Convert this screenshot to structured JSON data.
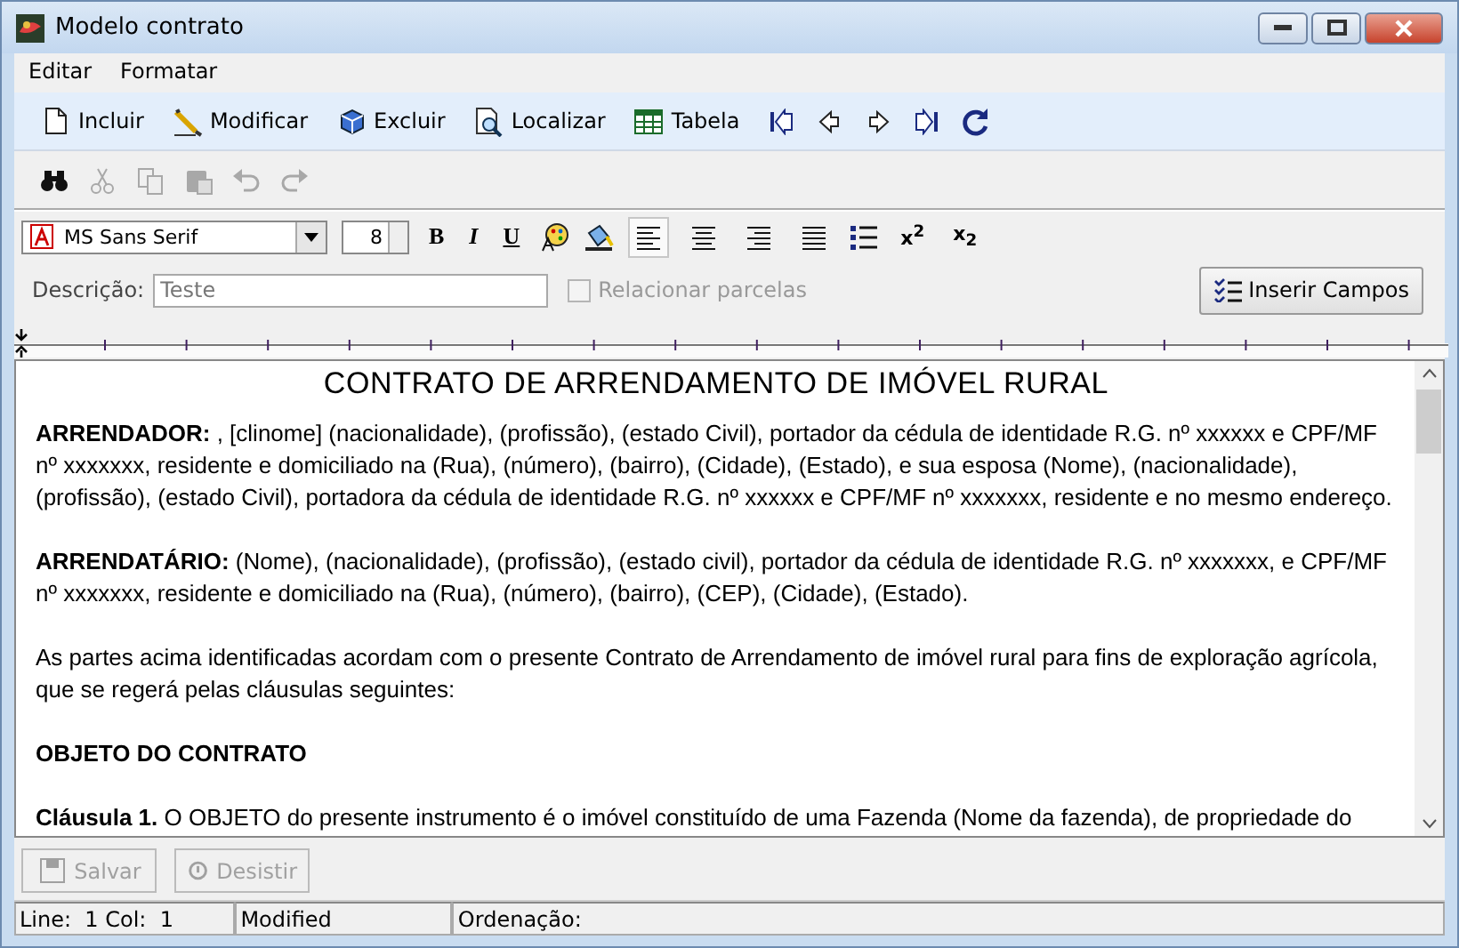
{
  "window": {
    "title": "Modelo contrato"
  },
  "menu": [
    {
      "label": "Editar"
    },
    {
      "label": "Formatar"
    }
  ],
  "toolbar": [
    {
      "kind": "new",
      "label": "Incluir"
    },
    {
      "kind": "edit",
      "label": "Modificar"
    },
    {
      "kind": "delete",
      "label": "Excluir"
    },
    {
      "kind": "find",
      "label": "Localizar"
    },
    {
      "kind": "table",
      "label": "Tabela"
    }
  ],
  "edit_tools": [
    {
      "kind": "binoculars",
      "disabled": false
    },
    {
      "kind": "cut",
      "disabled": true
    },
    {
      "kind": "copy",
      "disabled": true
    },
    {
      "kind": "paste",
      "disabled": true
    },
    {
      "kind": "undo",
      "disabled": true
    },
    {
      "kind": "redo",
      "disabled": true
    }
  ],
  "font": {
    "name": "MS Sans Serif",
    "size": "8"
  },
  "style_buttons": [
    {
      "kind": "bold",
      "label": "B"
    },
    {
      "kind": "italic",
      "label": "I"
    },
    {
      "kind": "underline",
      "label": "U"
    }
  ],
  "align_buttons": [
    {
      "kind": "left",
      "selected": true
    },
    {
      "kind": "center",
      "selected": false
    },
    {
      "kind": "right",
      "selected": false
    },
    {
      "kind": "justify",
      "selected": false
    }
  ],
  "script_buttons": [
    {
      "label": "x$^{2}$"
    },
    {
      "label": "x$_{2}$"
    }
  ],
  "description": {
    "label": "Descrição:",
    "value": "Teste"
  },
  "link_checkbox": {
    "label": "Relacionar parcelas",
    "checked": false,
    "disabled": true
  },
  "insert_button": {
    "label": "Inserir Campos"
  },
  "document": {
    "title": "CONTRATO DE ARRENDAMENTO DE IMÓVEL RURAL",
    "paragraphs": [
      "**ARRENDADOR:** , [clinome] (nacionalidade), (profissão), (estado Civil), portador da cédula de identidade R.G. nº xxxxxx e CPF/MF nº xxxxxxx, residente e domiciliado na (Rua), (número), (bairro), (Cidade), (Estado), e sua esposa (Nome), (nacionalidade), (profissão), (estado Civil), portadora da cédula de identidade R.G. nº xxxxxx e CPF/MF nº xxxxxxx, residente e no mesmo endereço.",
      "**ARRENDATÁRIO:** (Nome), (nacionalidade), (profissão), (estado civil), portador da cédula de identidade R.G. nº xxxxxxx, e CPF/MF nº xxxxxxx, residente e domiciliado na (Rua), (número), (bairro), (CEP), (Cidade), (Estado).",
      "As partes acima identificadas acordam com o presente Contrato de Arrendamento de imóvel rural para fins de exploração agrícola, que se regerá pelas cláusulas seguintes:",
      "**OBJETO DO CONTRATO**",
      "**Cláusula 1.** O OBJETO do presente instrumento é o imóvel constituído de uma Fazenda (Nome da fazenda), de propriedade do"
    ]
  },
  "actions": [
    {
      "label": "Salvar",
      "kind": "save",
      "disabled": true
    },
    {
      "label": "Desistir",
      "kind": "cancel",
      "disabled": true
    }
  ],
  "status_bar": [
    {
      "text": "Line:  1 Col:  1"
    },
    {
      "text": "Modified"
    },
    {
      "text": "Ordenação:"
    }
  ]
}
